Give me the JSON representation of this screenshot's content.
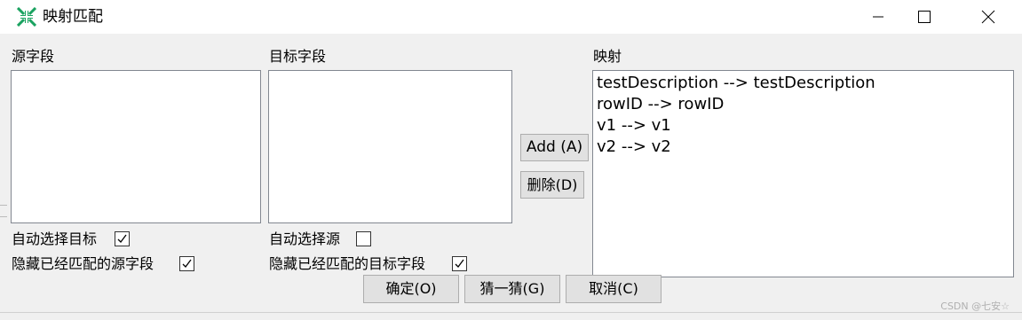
{
  "window": {
    "title": "映射匹配",
    "icon": "mapping-arrows-icon",
    "accent": "#1aa260"
  },
  "source": {
    "label": "源字段",
    "auto_select_label": "自动选择目标",
    "auto_select_checked": true,
    "hide_matched_label": "隐藏已经匹配的源字段",
    "hide_matched_checked": true
  },
  "target": {
    "label": "目标字段",
    "auto_select_label": "自动选择源",
    "auto_select_checked": false,
    "hide_matched_label": "隐藏已经匹配的目标字段",
    "hide_matched_checked": true
  },
  "mapping": {
    "label": "映射",
    "items": [
      "testDescription --> testDescription",
      "rowID --> rowID",
      "v1 --> v1",
      "v2 --> v2"
    ]
  },
  "buttons": {
    "add": "Add (A)",
    "delete": "删除(D)",
    "ok": "确定(O)",
    "guess": "猜一猜(G)",
    "cancel": "取消(C)"
  },
  "watermark": "CSDN @七安☆"
}
